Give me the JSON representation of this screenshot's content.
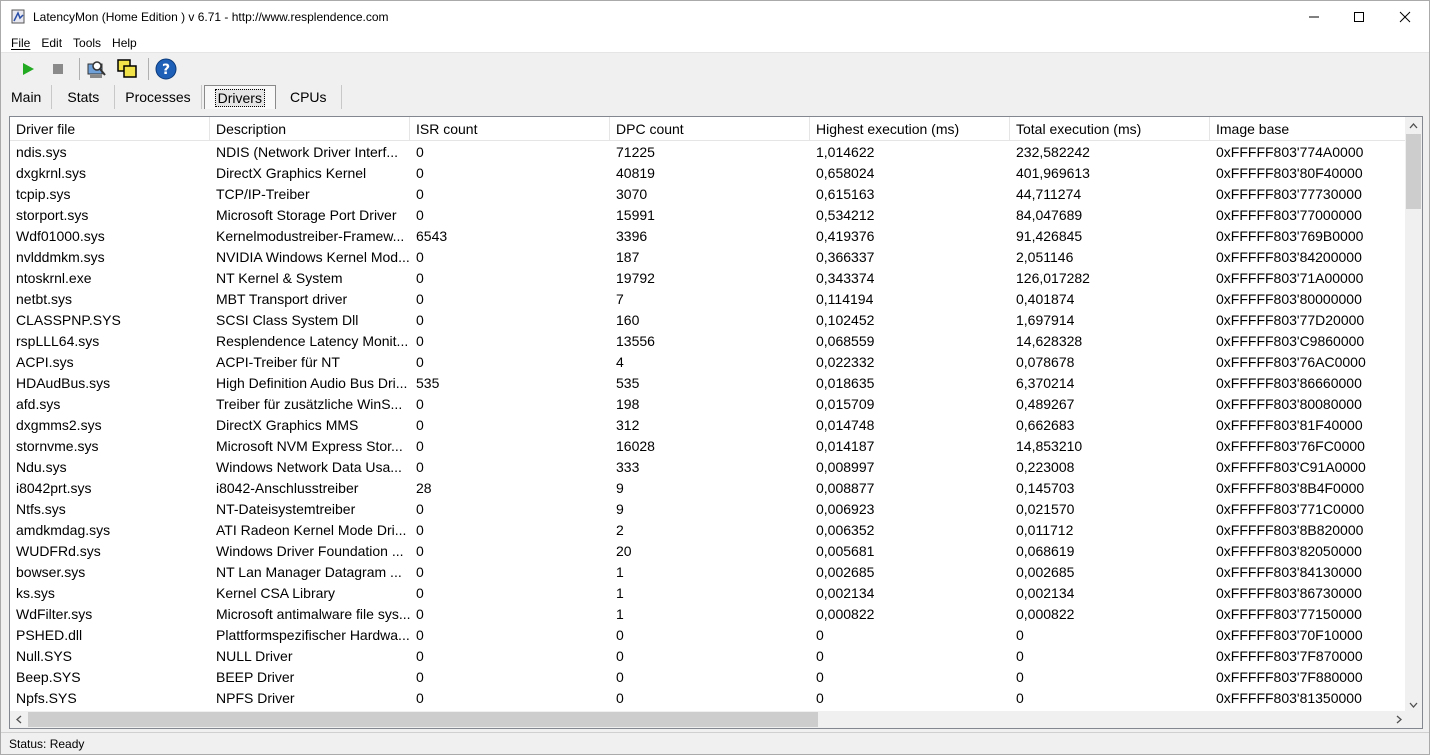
{
  "window": {
    "title": "LatencyMon  (Home Edition )  v 6.71 - http://www.resplendence.com",
    "minimize_icon": "minimize-icon",
    "maximize_icon": "maximize-icon",
    "close_icon": "close-icon"
  },
  "menu": [
    "File",
    "Edit",
    "Tools",
    "Help"
  ],
  "toolbar": {
    "icons": [
      "play-icon",
      "stop-icon",
      "search-icon",
      "windows-icon",
      "help-icon"
    ],
    "colors": {
      "play": "#22aa22",
      "stop": "#8a8a8a",
      "help": "#1e5fb8"
    }
  },
  "tabs": [
    {
      "label": "Main",
      "active": false
    },
    {
      "label": "Stats",
      "active": false
    },
    {
      "label": "Processes",
      "active": false
    },
    {
      "label": "Drivers",
      "active": true
    },
    {
      "label": "CPUs",
      "active": false
    }
  ],
  "table": {
    "columns": [
      "Driver file",
      "Description",
      "ISR count",
      "DPC count",
      "Highest execution (ms)",
      "Total execution (ms)",
      "Image base"
    ],
    "rows": [
      [
        "ndis.sys",
        "NDIS (Network Driver Interf...",
        "0",
        "71225",
        "1,014622",
        "232,582242",
        "0xFFFFF803'774A0000"
      ],
      [
        "dxgkrnl.sys",
        "DirectX Graphics Kernel",
        "0",
        "40819",
        "0,658024",
        "401,969613",
        "0xFFFFF803'80F40000"
      ],
      [
        "tcpip.sys",
        "TCP/IP-Treiber",
        "0",
        "3070",
        "0,615163",
        "44,711274",
        "0xFFFFF803'77730000"
      ],
      [
        "storport.sys",
        "Microsoft Storage Port Driver",
        "0",
        "15991",
        "0,534212",
        "84,047689",
        "0xFFFFF803'77000000"
      ],
      [
        "Wdf01000.sys",
        "Kernelmodustreiber-Framew...",
        "6543",
        "3396",
        "0,419376",
        "91,426845",
        "0xFFFFF803'769B0000"
      ],
      [
        "nvlddmkm.sys",
        "NVIDIA Windows Kernel Mod...",
        "0",
        "187",
        "0,366337",
        "2,051146",
        "0xFFFFF803'84200000"
      ],
      [
        "ntoskrnl.exe",
        "NT Kernel & System",
        "0",
        "19792",
        "0,343374",
        "126,017282",
        "0xFFFFF803'71A00000"
      ],
      [
        "netbt.sys",
        "MBT Transport driver",
        "0",
        "7",
        "0,114194",
        "0,401874",
        "0xFFFFF803'80000000"
      ],
      [
        "CLASSPNP.SYS",
        "SCSI Class System Dll",
        "0",
        "160",
        "0,102452",
        "1,697914",
        "0xFFFFF803'77D20000"
      ],
      [
        "rspLLL64.sys",
        "Resplendence Latency Monit...",
        "0",
        "13556",
        "0,068559",
        "14,628328",
        "0xFFFFF803'C9860000"
      ],
      [
        "ACPI.sys",
        "ACPI-Treiber für NT",
        "0",
        "4",
        "0,022332",
        "0,078678",
        "0xFFFFF803'76AC0000"
      ],
      [
        "HDAudBus.sys",
        "High Definition Audio Bus Dri...",
        "535",
        "535",
        "0,018635",
        "6,370214",
        "0xFFFFF803'86660000"
      ],
      [
        "afd.sys",
        "Treiber für zusätzliche WinS...",
        "0",
        "198",
        "0,015709",
        "0,489267",
        "0xFFFFF803'80080000"
      ],
      [
        "dxgmms2.sys",
        "DirectX Graphics MMS",
        "0",
        "312",
        "0,014748",
        "0,662683",
        "0xFFFFF803'81F40000"
      ],
      [
        "stornvme.sys",
        "Microsoft NVM Express Stor...",
        "0",
        "16028",
        "0,014187",
        "14,853210",
        "0xFFFFF803'76FC0000"
      ],
      [
        "Ndu.sys",
        "Windows Network Data Usa...",
        "0",
        "333",
        "0,008997",
        "0,223008",
        "0xFFFFF803'C91A0000"
      ],
      [
        "i8042prt.sys",
        "i8042-Anschlusstreiber",
        "28",
        "9",
        "0,008877",
        "0,145703",
        "0xFFFFF803'8B4F0000"
      ],
      [
        "Ntfs.sys",
        "NT-Dateisystemtreiber",
        "0",
        "9",
        "0,006923",
        "0,021570",
        "0xFFFFF803'771C0000"
      ],
      [
        "amdkmdag.sys",
        "ATI Radeon Kernel Mode Dri...",
        "0",
        "2",
        "0,006352",
        "0,011712",
        "0xFFFFF803'8B820000"
      ],
      [
        "WUDFRd.sys",
        "Windows Driver Foundation ...",
        "0",
        "20",
        "0,005681",
        "0,068619",
        "0xFFFFF803'82050000"
      ],
      [
        "bowser.sys",
        "NT Lan Manager Datagram ...",
        "0",
        "1",
        "0,002685",
        "0,002685",
        "0xFFFFF803'84130000"
      ],
      [
        "ks.sys",
        "Kernel CSA Library",
        "0",
        "1",
        "0,002134",
        "0,002134",
        "0xFFFFF803'86730000"
      ],
      [
        "WdFilter.sys",
        "Microsoft antimalware file sys...",
        "0",
        "1",
        "0,000822",
        "0,000822",
        "0xFFFFF803'77150000"
      ],
      [
        "PSHED.dll",
        "Plattformspezifischer Hardwa...",
        "0",
        "0",
        "0",
        "0",
        "0xFFFFF803'70F10000"
      ],
      [
        "Null.SYS",
        "NULL Driver",
        "0",
        "0",
        "0",
        "0",
        "0xFFFFF803'7F870000"
      ],
      [
        "Beep.SYS",
        "BEEP Driver",
        "0",
        "0",
        "0",
        "0",
        "0xFFFFF803'7F880000"
      ],
      [
        "Npfs.SYS",
        "NPFS Driver",
        "0",
        "0",
        "0",
        "0",
        "0xFFFFF803'81350000"
      ]
    ]
  },
  "status": "Status: Ready"
}
